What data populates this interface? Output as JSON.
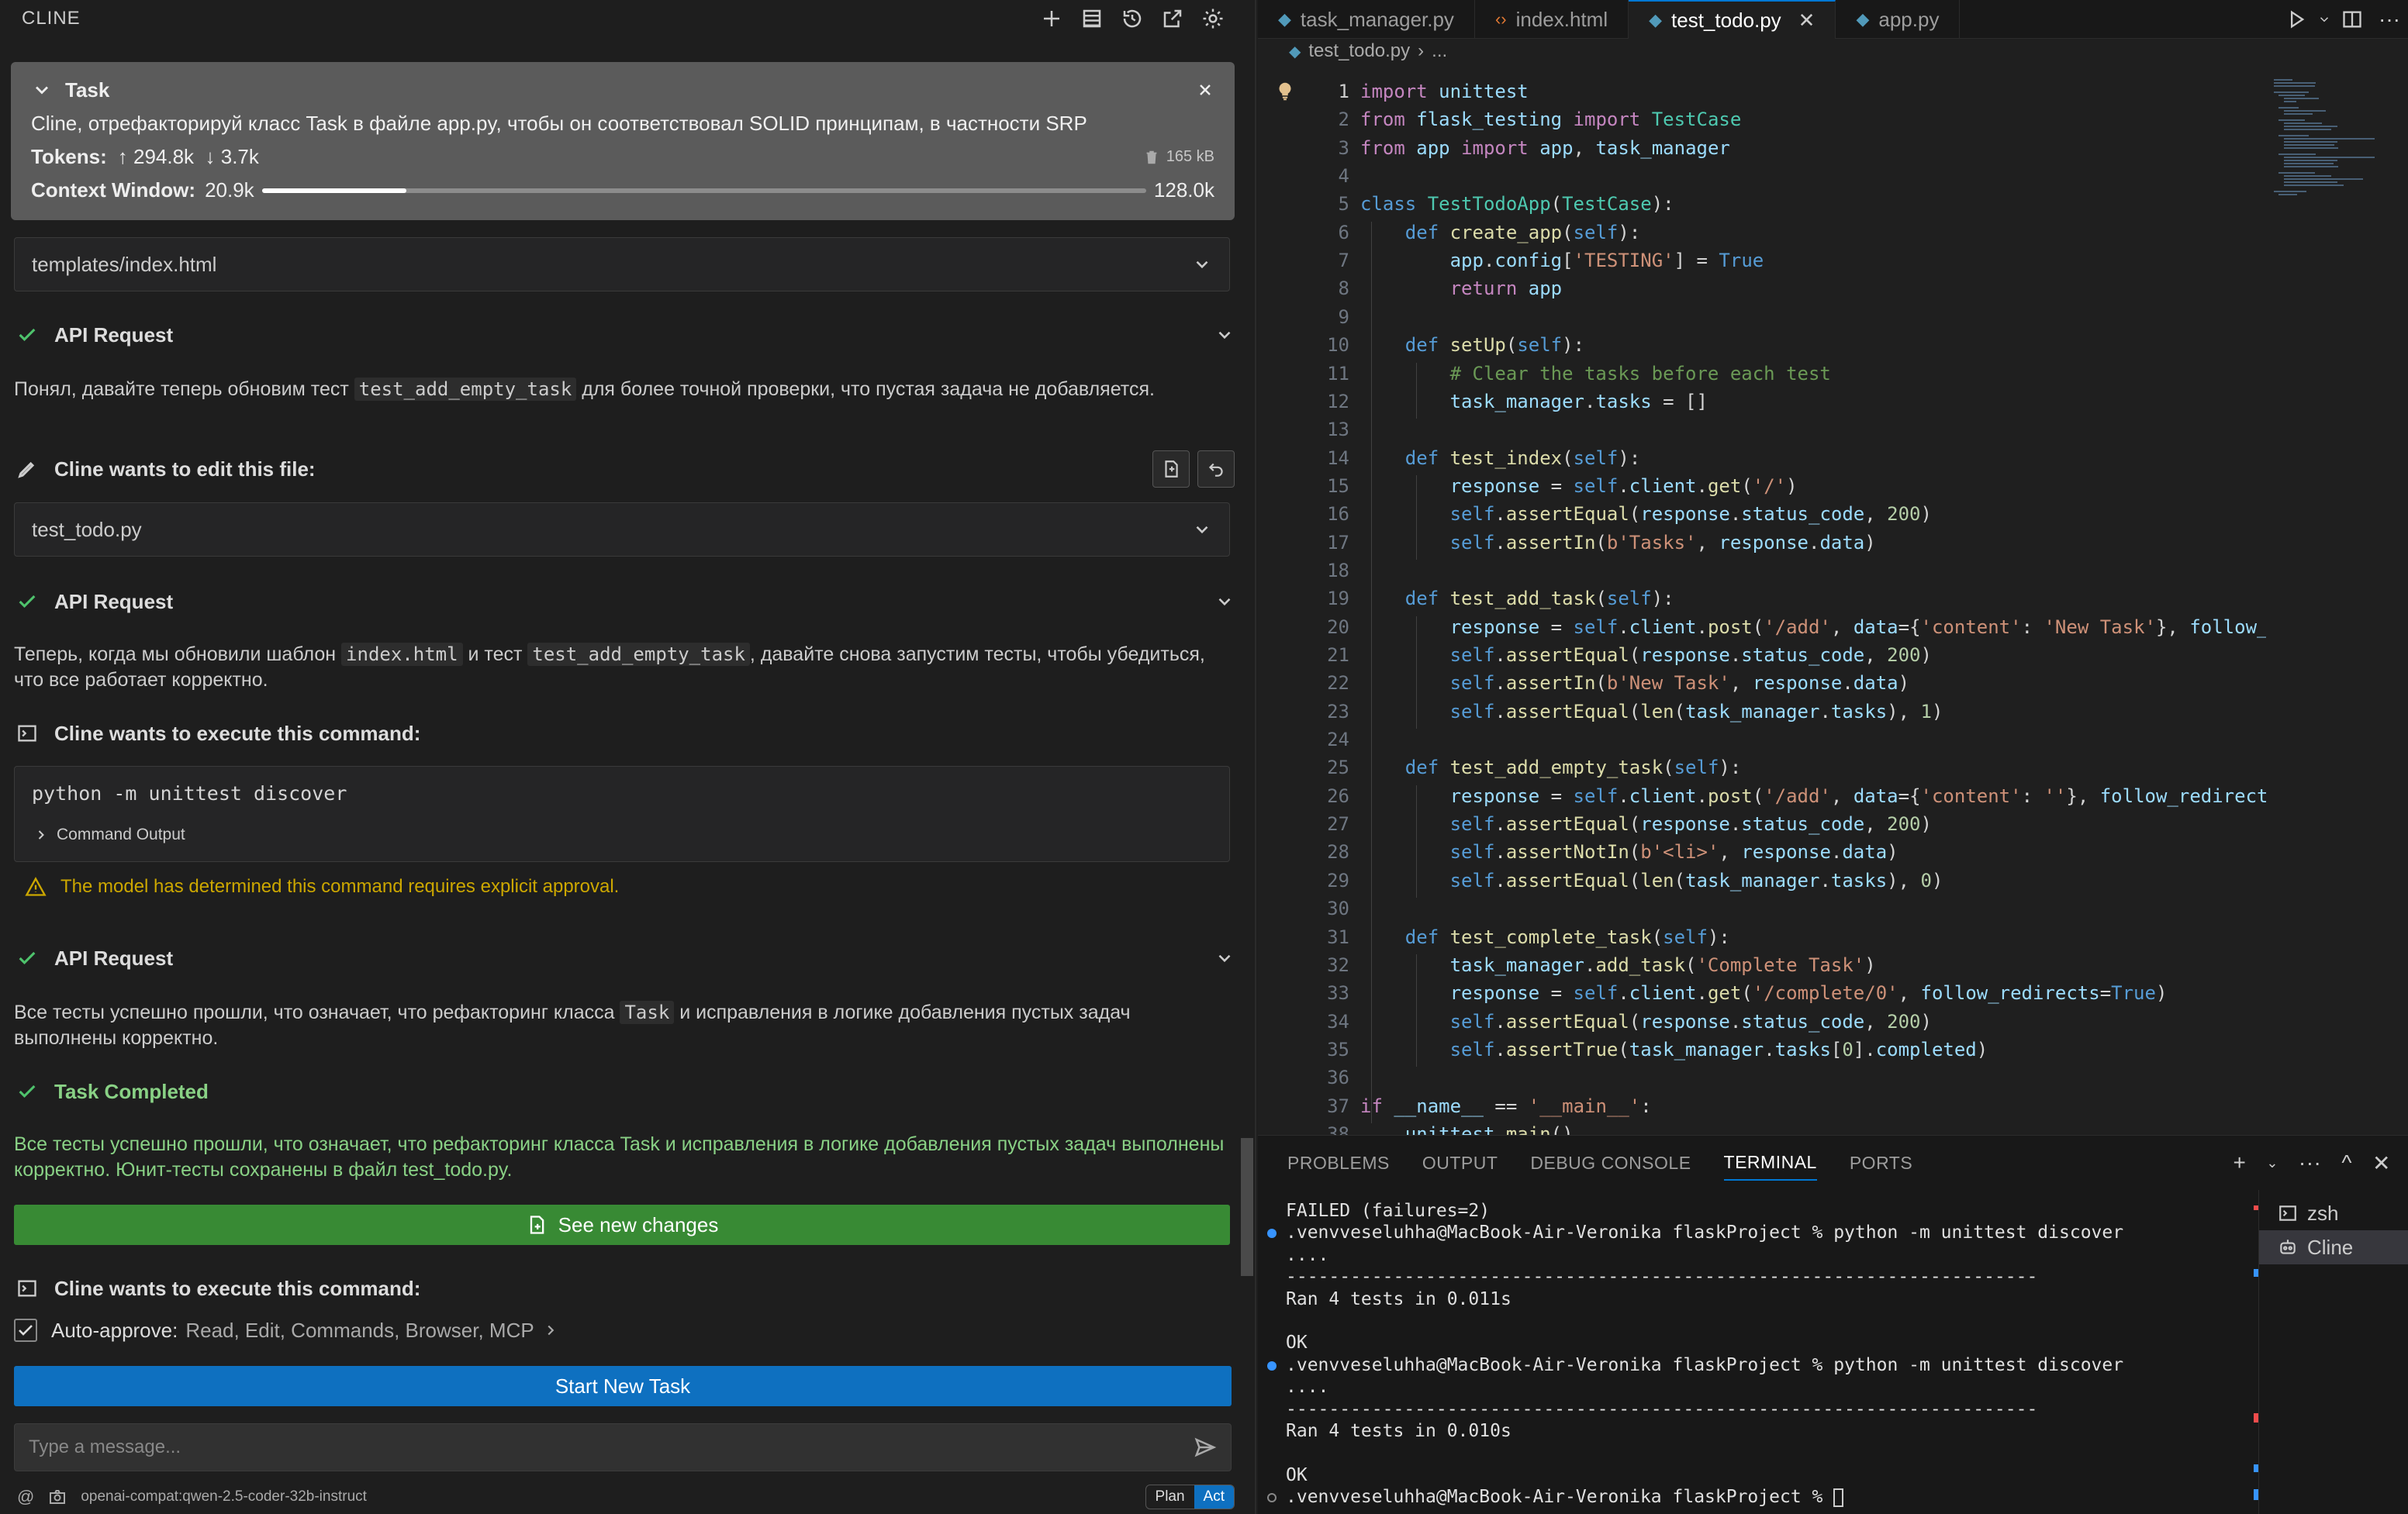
{
  "cline": {
    "header_title": "CLINE",
    "task": {
      "label": "Task",
      "description": "Cline, отрефакторируй класс Task в файле app.py, чтобы он соответствовал SOLID принципам, в частности SRP",
      "tokens_label": "Tokens:",
      "tokens_in": "↑ 294.8k",
      "tokens_out": "↓ 3.7k",
      "size": "165 kB",
      "context_label": "Context Window:",
      "context_used": "20.9k",
      "context_max": "128.0k",
      "context_fraction": 0.163
    },
    "file_row_1": "templates/index.html",
    "api_request_label": "API Request",
    "msg1_pre": "Понял, давайте теперь обновим тест ",
    "msg1_code": "test_add_empty_task",
    "msg1_post": " для более точной проверки, что пустая задача не добавляется.",
    "edit_label": "Cline wants to edit this file:",
    "file_row_2": "test_todo.py",
    "msg2_a": "Теперь, когда мы обновили шаблон ",
    "msg2_code1": "index.html",
    "msg2_b": " и тест ",
    "msg2_code2": "test_add_empty_task",
    "msg2_c": ", давайте снова запустим тесты, чтобы убедиться, что все работает корректно.",
    "execute_label": "Cline wants to execute this command:",
    "command": "python -m unittest discover",
    "command_output_label": "Command Output",
    "warning": "The model has determined this command requires explicit approval.",
    "msg3_a": "Все тесты успешно прошли, что означает, что рефакторинг класса ",
    "msg3_code": "Task",
    "msg3_b": " и исправления в логике добавления пустых задач выполнены корректно.",
    "task_completed_label": "Task Completed",
    "completed_text": "Все тесты успешно прошли, что означает, что рефакторинг класса Task и исправления в логике добавления пустых задач выполнены корректно. Юнит-тесты сохранены в файл test_todo.py.",
    "see_changes_label": "See new changes",
    "execute_label_2": "Cline wants to execute this command:",
    "auto_approve_label": "Auto-approve:",
    "auto_approve_items": "Read, Edit, Commands, Browser, MCP",
    "start_new_task_label": "Start New Task",
    "message_placeholder": "Type a message...",
    "model": "openai-compat:qwen-2.5-coder-32b-instruct",
    "mode_plan": "Plan",
    "mode_act": "Act"
  },
  "editor": {
    "tabs": [
      {
        "label": "task_manager.py",
        "icon": "python-icon"
      },
      {
        "label": "index.html",
        "icon": "html-icon"
      },
      {
        "label": "test_todo.py",
        "icon": "python-icon",
        "active": true
      },
      {
        "label": "app.py",
        "icon": "python-icon"
      }
    ],
    "breadcrumb_file": "test_todo.py",
    "breadcrumb_rest": "...",
    "current_line": 1,
    "lines": [
      "import unittest",
      "from flask_testing import TestCase",
      "from app import app, task_manager",
      "",
      "class TestTodoApp(TestCase):",
      "    def create_app(self):",
      "        app.config['TESTING'] = True",
      "        return app",
      "",
      "    def setUp(self):",
      "        # Clear the tasks before each test",
      "        task_manager.tasks = []",
      "",
      "    def test_index(self):",
      "        response = self.client.get('/')",
      "        self.assertEqual(response.status_code, 200)",
      "        self.assertIn(b'Tasks', response.data)",
      "",
      "    def test_add_task(self):",
      "        response = self.client.post('/add', data={'content': 'New Task'}, follow_",
      "        self.assertEqual(response.status_code, 200)",
      "        self.assertIn(b'New Task', response.data)",
      "        self.assertEqual(len(task_manager.tasks), 1)",
      "",
      "    def test_add_empty_task(self):",
      "        response = self.client.post('/add', data={'content': ''}, follow_redirect",
      "        self.assertEqual(response.status_code, 200)",
      "        self.assertNotIn(b'<li>', response.data)",
      "        self.assertEqual(len(task_manager.tasks), 0)",
      "",
      "    def test_complete_task(self):",
      "        task_manager.add_task('Complete Task')",
      "        response = self.client.get('/complete/0', follow_redirects=True)",
      "        self.assertEqual(response.status_code, 200)",
      "        self.assertTrue(task_manager.tasks[0].completed)",
      "",
      "if __name__ == '__main__':",
      "    unittest.main()"
    ]
  },
  "panel": {
    "tabs": [
      "PROBLEMS",
      "OUTPUT",
      "DEBUG CONSOLE",
      "TERMINAL",
      "PORTS"
    ],
    "active_tab": "TERMINAL",
    "terminal_lines": [
      "FAILED (failures=2)",
      ".venvveseluhha@MacBook-Air-Veronika flaskProject % python -m unittest discover",
      "....",
      "----------------------------------------------------------------------",
      "Ran 4 tests in 0.011s",
      "",
      "OK",
      ".venvveseluhha@MacBook-Air-Veronika flaskProject % python -m unittest discover",
      "....",
      "----------------------------------------------------------------------",
      "Ran 4 tests in 0.010s",
      "",
      "OK",
      ".venvveseluhha@MacBook-Air-Veronika flaskProject % "
    ],
    "terminals": [
      "zsh",
      "Cline"
    ],
    "selected_terminal": "Cline"
  }
}
